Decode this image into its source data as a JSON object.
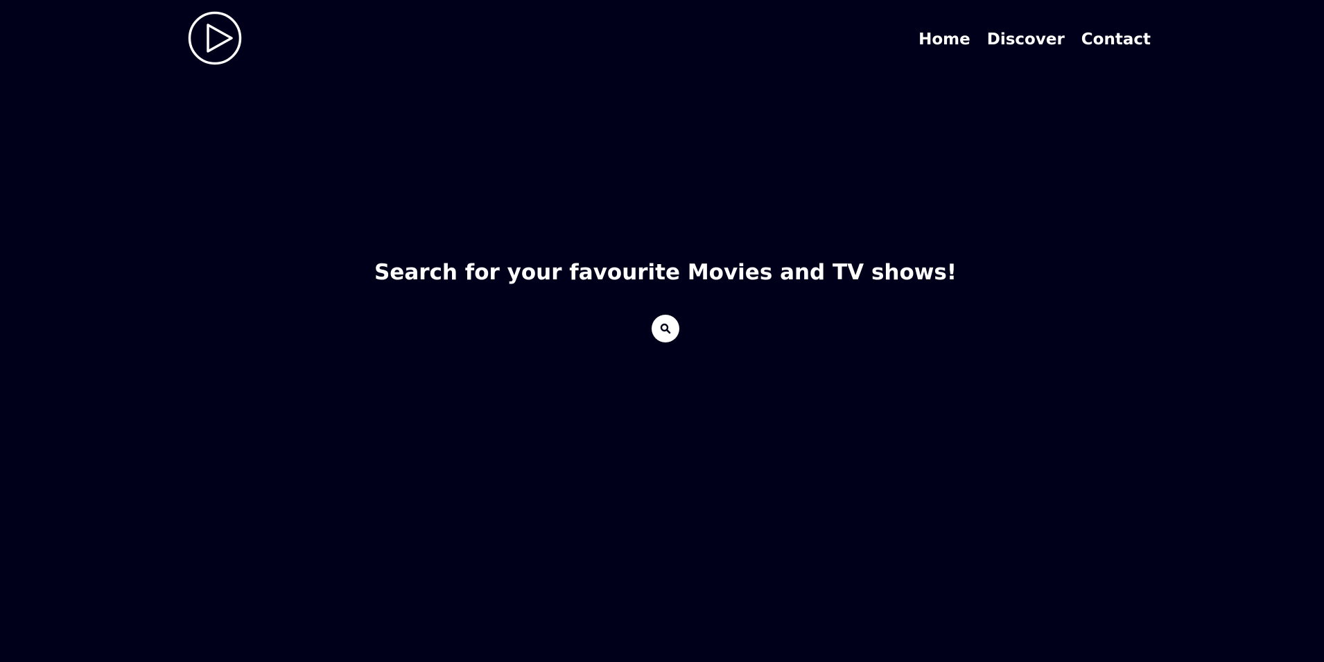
{
  "header": {
    "logo_icon": "play-circle-icon",
    "nav": [
      {
        "label": "Home"
      },
      {
        "label": "Discover"
      },
      {
        "label": "Contact"
      }
    ]
  },
  "hero": {
    "title": "Search for your favourite Movies and TV shows!",
    "search_icon": "search-icon"
  },
  "colors": {
    "background": "#00001b",
    "foreground": "#ffffff"
  }
}
